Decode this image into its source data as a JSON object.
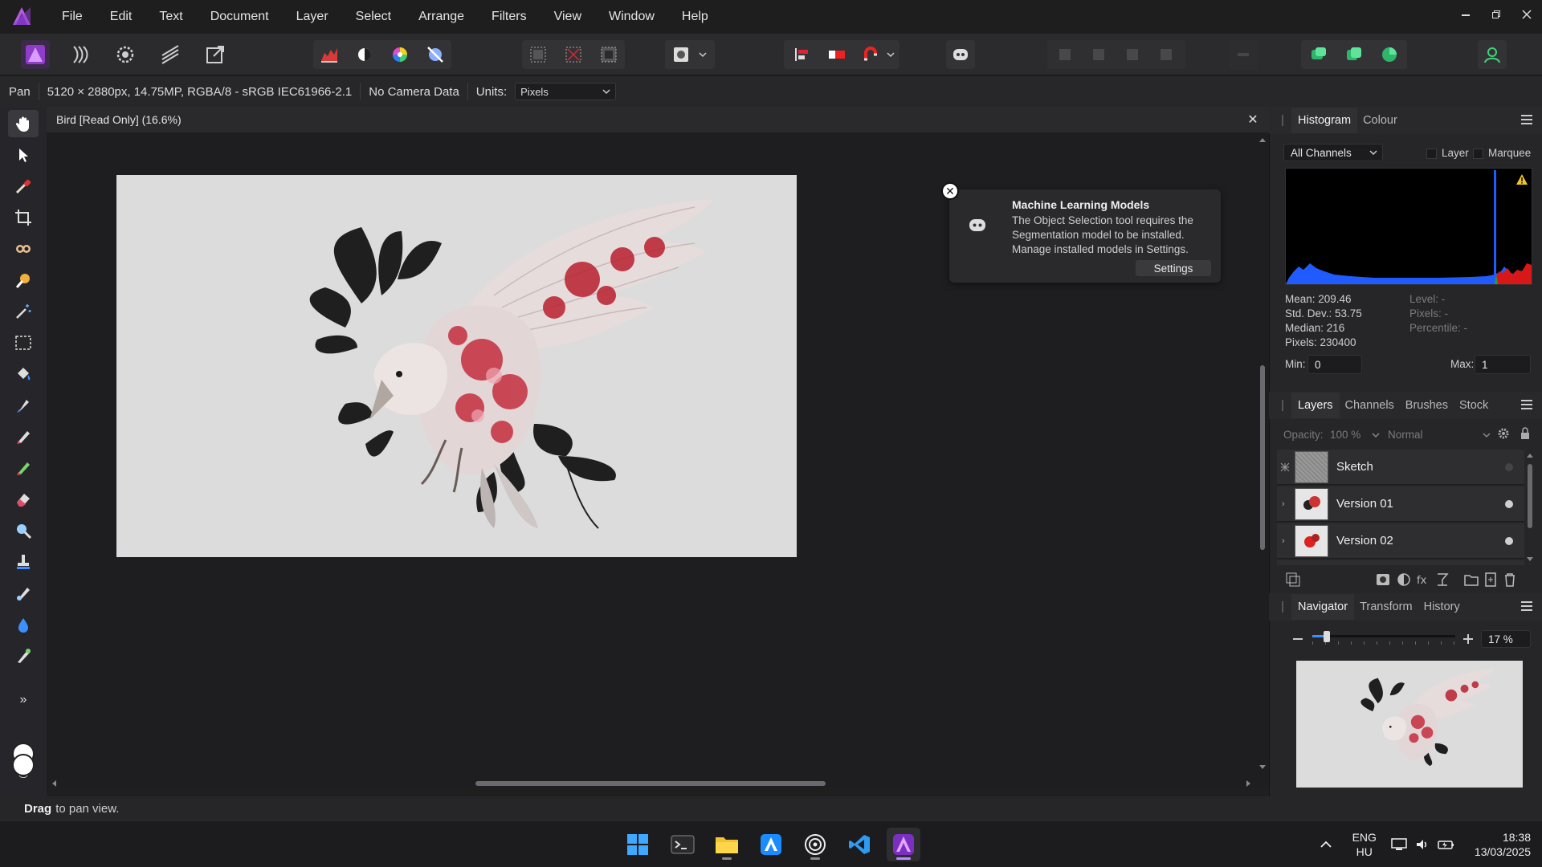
{
  "menu": [
    "File",
    "Edit",
    "Text",
    "Document",
    "Layer",
    "Select",
    "Arrange",
    "Filters",
    "View",
    "Window",
    "Help"
  ],
  "context": {
    "tool_name": "Pan",
    "doc_info": "5120 × 2880px, 14.75MP, RGBA/8 - sRGB IEC61966-2.1",
    "camera": "No Camera Data",
    "units_label": "Units:",
    "units_value": "Pixels"
  },
  "document": {
    "tab_title": "Bird [Read Only] (16.6%)",
    "close_glyph": "✕"
  },
  "notification": {
    "title": "Machine Learning Models",
    "message": "The Object Selection tool requires the Segmentation model to be installed. Manage installed models in Settings.",
    "button": "Settings"
  },
  "histogram": {
    "tabs": [
      "Histogram",
      "Colour"
    ],
    "channel": "All Channels",
    "layer_label": "Layer",
    "marquee_label": "Marquee",
    "stats_left": [
      "Mean: 209.46",
      "Std. Dev.: 53.75",
      "Median: 216",
      "Pixels: 230400"
    ],
    "stats_right": [
      "Level: -",
      "Pixels: -",
      "Percentile: -"
    ],
    "min_label": "Min:",
    "min_value": "0",
    "max_label": "Max:",
    "max_value": "1"
  },
  "layers": {
    "tabs": [
      "Layers",
      "Channels",
      "Brushes",
      "Stock"
    ],
    "opacity_label": "Opacity:",
    "opacity_value": "100 %",
    "blend_mode": "Normal",
    "items": [
      {
        "name": "Sketch"
      },
      {
        "name": "Version 01"
      },
      {
        "name": "Version 02"
      }
    ]
  },
  "navigator": {
    "tabs": [
      "Navigator",
      "Transform",
      "History"
    ],
    "zoom": "17 %",
    "zoom_slider_fraction": 0.08
  },
  "status": {
    "action": "Drag",
    "hint": "to pan view."
  },
  "taskbar": {
    "lang_top": "ENG",
    "lang_bottom": "HU",
    "time": "18:38",
    "date": "13/03/2025"
  },
  "colors": {
    "accent_purple": "#a24bd6",
    "histogram_blue": "#1f5bff",
    "histogram_red": "#d81818"
  }
}
